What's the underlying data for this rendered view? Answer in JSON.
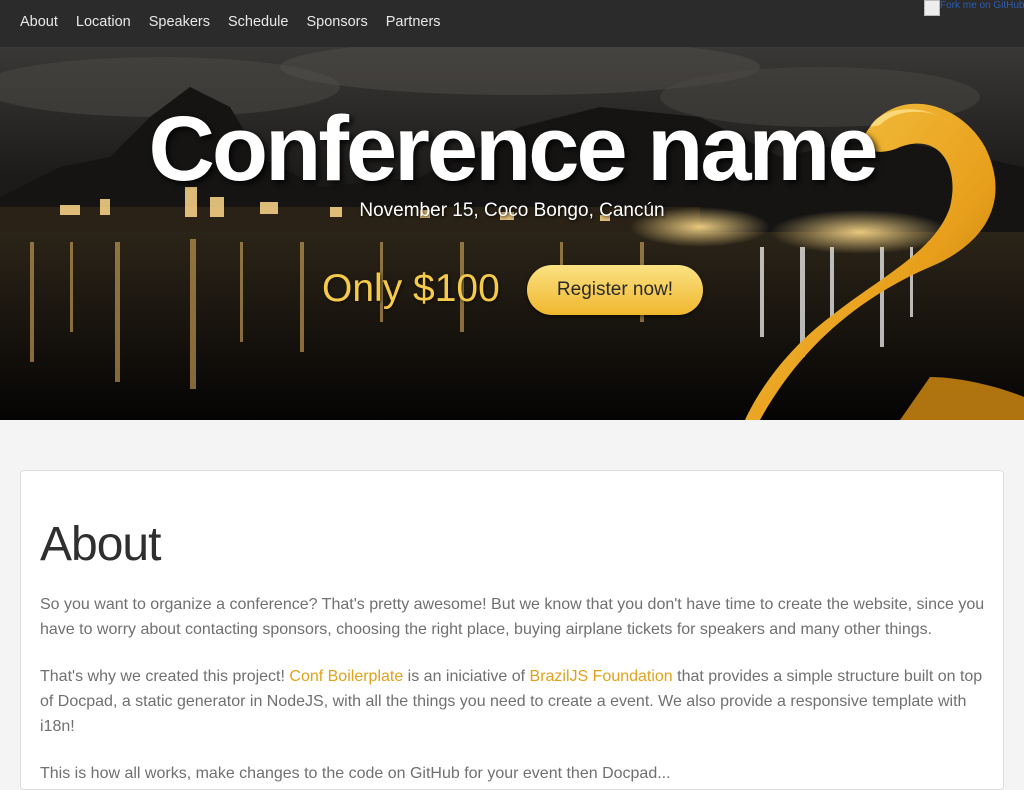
{
  "nav": {
    "items": [
      {
        "label": "About"
      },
      {
        "label": "Location"
      },
      {
        "label": "Speakers"
      },
      {
        "label": "Schedule"
      },
      {
        "label": "Sponsors"
      },
      {
        "label": "Partners"
      }
    ],
    "fork_alt": "Fork me on GitHub"
  },
  "hero": {
    "title": "Conference name",
    "subtitle": "November 15, Coco Bongo, Cancún",
    "price": "Only $100",
    "register_label": "Register now!"
  },
  "about": {
    "heading": "About",
    "p1": "So you want to organize a conference? That's pretty awesome! But we know that you don't have time to create the website, since you have to worry about contacting sponsors, choosing the right place, buying airplane tickets for speakers and many other things.",
    "p2_a": "That's why we created this project! ",
    "p2_link1": "Conf Boilerplate",
    "p2_b": " is an iniciative of ",
    "p2_link2": "BrazilJS Foundation",
    "p2_c": " that provides a simple structure built on top of Docpad, a static generator in NodeJS, with all the things you need to create a event. We also provide a responsive template with i18n!",
    "p3": "This is how all works, make changes to the code on GitHub for your event then Docpad..."
  },
  "colors": {
    "nav_bg": "#2b2b2b",
    "accent": "#e1a21a",
    "price": "#f5c94a",
    "button": "#f0b72e"
  }
}
